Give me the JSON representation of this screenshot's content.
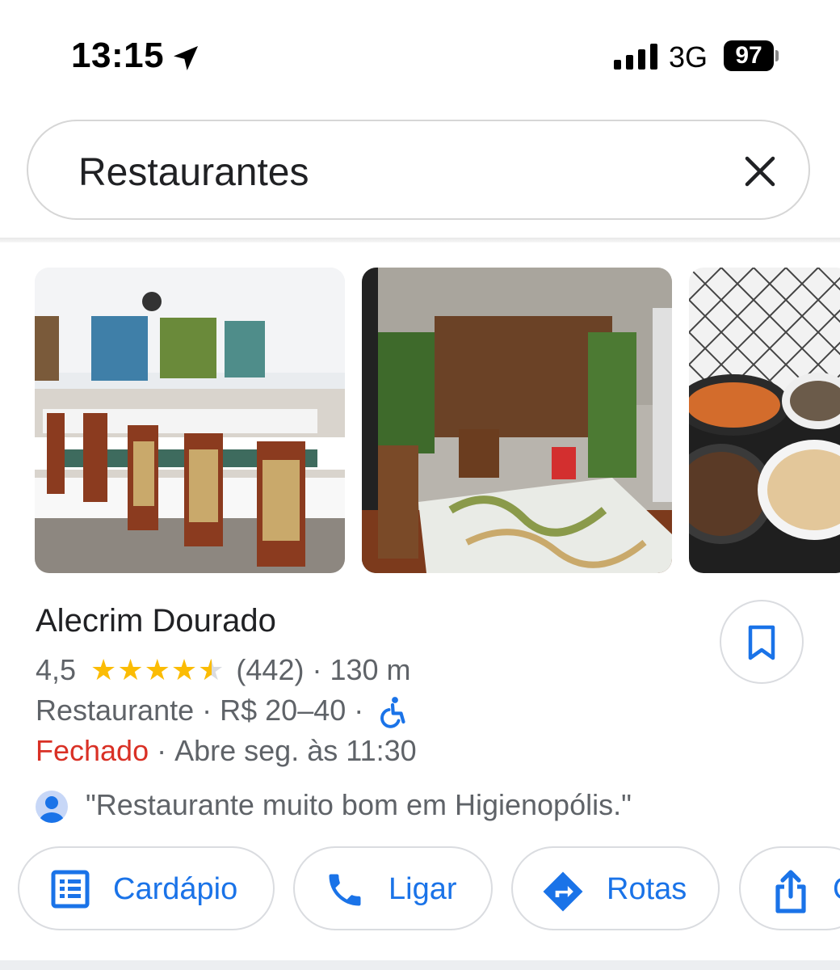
{
  "status_bar": {
    "time": "13:15",
    "network": "3G",
    "battery": "97"
  },
  "search": {
    "query": "Restaurantes"
  },
  "place": {
    "name": "Alecrim Dourado",
    "rating": "4,5",
    "rating_value": 4.5,
    "review_count": "(442)",
    "distance": "130 m",
    "category": "Restaurante",
    "price": "R$ 20–40",
    "status": "Fechado",
    "hours": "Abre seg. às 11:30",
    "review_snippet": "\"Restaurante muito bom em Higienopólis.\"",
    "separator": "·"
  },
  "actions": [
    {
      "label": "Cardápio"
    },
    {
      "label": "Ligar"
    },
    {
      "label": "Rotas"
    },
    {
      "label": "C"
    }
  ],
  "colors": {
    "accent": "#1a73e8",
    "star": "#fbbc04",
    "closed": "#d93025"
  }
}
